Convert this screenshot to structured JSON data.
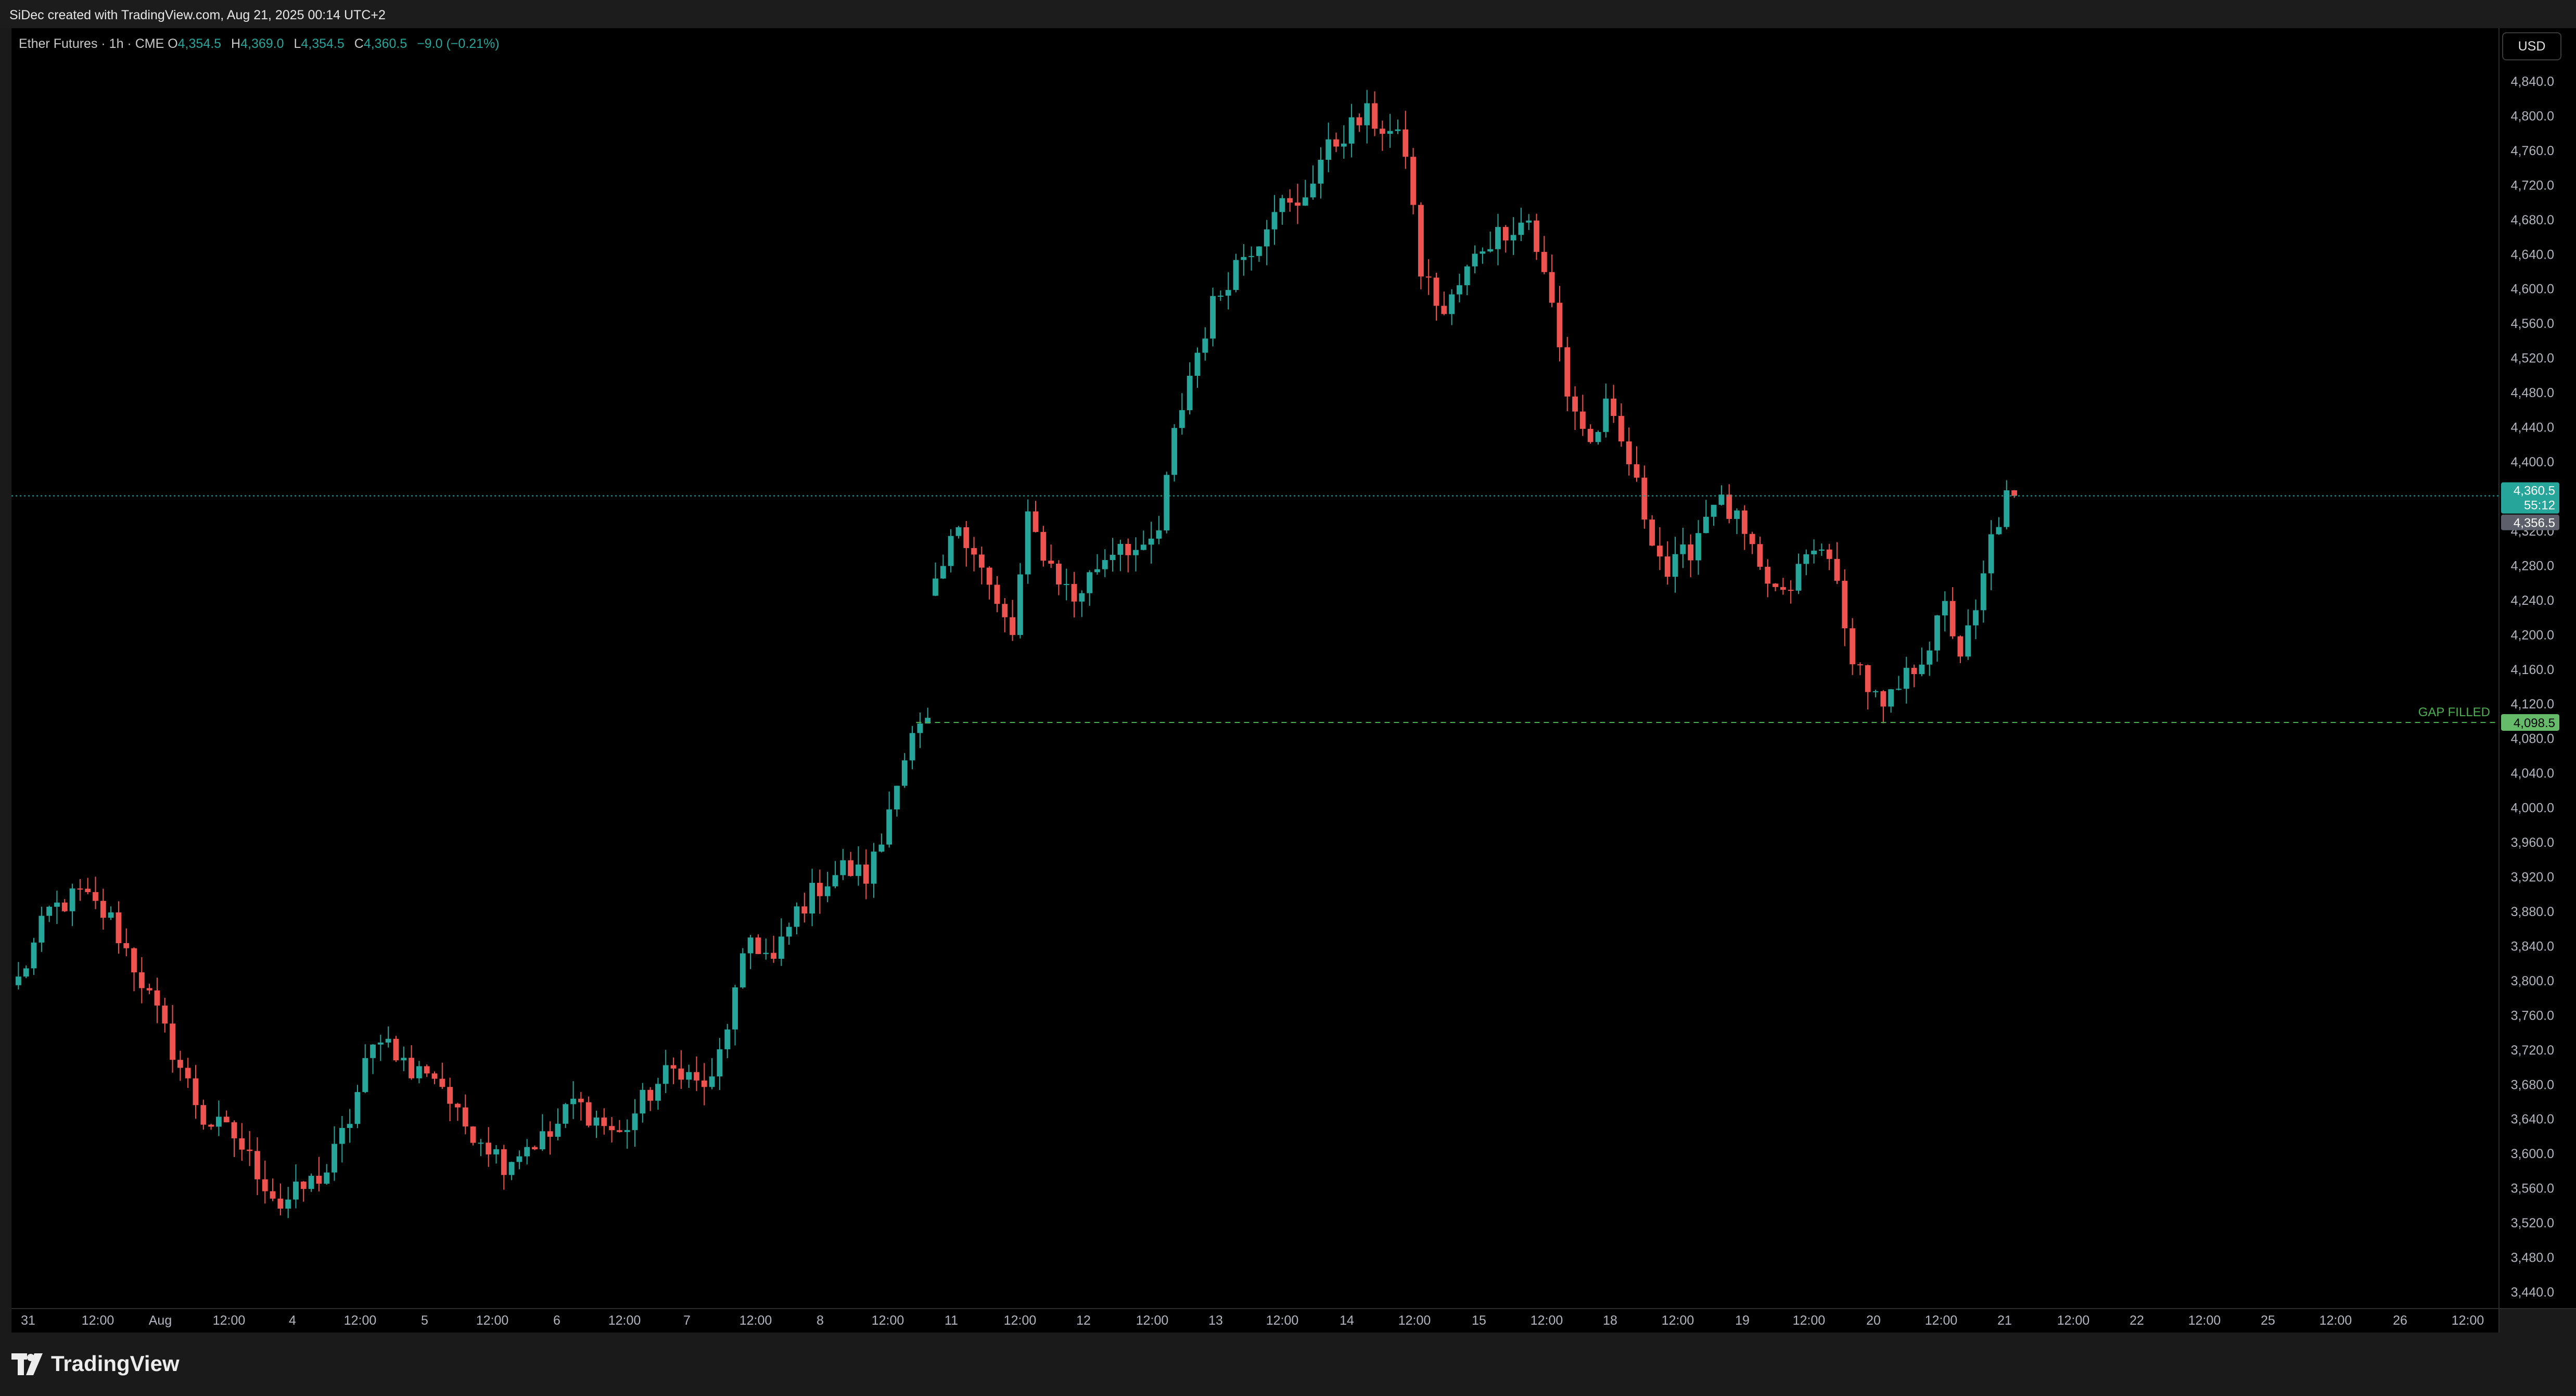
{
  "header": {
    "credit": "SiDec created with TradingView.com, Aug 21, 2025 00:14 UTC+2"
  },
  "legend": {
    "symbol": "Ether Futures · 1h · CME",
    "open_label": "O",
    "open": "4,354.5",
    "high_label": "H",
    "high": "4,369.0",
    "low_label": "L",
    "low": "4,354.5",
    "close_label": "C",
    "close": "4,360.5",
    "change": "−9.0 (−0.21%)"
  },
  "currency_button": "USD",
  "brand": {
    "name": "TradingView",
    "icon": "tradingview-logo-icon"
  },
  "colors": {
    "up": "#26a69a",
    "down": "#ef5350",
    "price_line": "#26a69a",
    "gap_line": "#4caf50",
    "background": "#000000"
  },
  "price_tags": {
    "last_price": "4,360.5",
    "countdown": "55:12",
    "prev_close": "4,356.5",
    "gap_price": "4,098.5"
  },
  "annotation": {
    "gap_label": "GAP FILLED"
  },
  "chart_data": {
    "type": "candlestick",
    "ylim": [
      3420,
      4860
    ],
    "y_ticks": [
      "4,840.0",
      "4,800.0",
      "4,760.0",
      "4,720.0",
      "4,680.0",
      "4,640.0",
      "4,600.0",
      "4,560.0",
      "4,520.0",
      "4,480.0",
      "4,440.0",
      "4,400.0",
      "4,360.0",
      "4,320.0",
      "4,280.0",
      "4,240.0",
      "4,200.0",
      "4,160.0",
      "4,120.0",
      "4,080.0",
      "4,040.0",
      "4,000.0",
      "3,960.0",
      "3,920.0",
      "3,880.0",
      "3,840.0",
      "3,800.0",
      "3,760.0",
      "3,720.0",
      "3,680.0",
      "3,640.0",
      "3,600.0",
      "3,560.0",
      "3,520.0",
      "3,480.0",
      "3,440.0"
    ],
    "x_ticks": [
      "31",
      "12:00",
      "Aug",
      "12:00",
      "4",
      "12:00",
      "5",
      "12:00",
      "6",
      "12:00",
      "7",
      "12:00",
      "8",
      "12:00",
      "11",
      "12:00",
      "12",
      "12:00",
      "13",
      "12:00",
      "14",
      "12:00",
      "15",
      "12:00",
      "18",
      "12:00",
      "19",
      "12:00",
      "20",
      "12:00",
      "21",
      "12:00",
      "22",
      "12:00",
      "25",
      "12:00",
      "26",
      "12:00"
    ],
    "last_price": 4360.5,
    "gap_level": 4098.5,
    "path_points": [
      [
        0,
        3800
      ],
      [
        4,
        3880
      ],
      [
        8,
        3900
      ],
      [
        12,
        3870
      ],
      [
        16,
        3800
      ],
      [
        18,
        3760
      ],
      [
        21,
        3700
      ],
      [
        24,
        3640
      ],
      [
        28,
        3620
      ],
      [
        31,
        3580
      ],
      [
        34,
        3540
      ],
      [
        37,
        3560
      ],
      [
        40,
        3580
      ],
      [
        43,
        3640
      ],
      [
        45,
        3700
      ],
      [
        47,
        3740
      ],
      [
        49,
        3720
      ],
      [
        51,
        3690
      ],
      [
        53,
        3700
      ],
      [
        55,
        3680
      ],
      [
        57,
        3640
      ],
      [
        60,
        3620
      ],
      [
        63,
        3590
      ],
      [
        66,
        3610
      ],
      [
        69,
        3620
      ],
      [
        72,
        3660
      ],
      [
        75,
        3640
      ],
      [
        78,
        3620
      ],
      [
        81,
        3660
      ],
      [
        84,
        3690
      ],
      [
        86,
        3700
      ],
      [
        88,
        3680
      ],
      [
        90,
        3680
      ],
      [
        92,
        3750
      ],
      [
        95,
        3850
      ],
      [
        98,
        3820
      ],
      [
        101,
        3880
      ],
      [
        104,
        3910
      ],
      [
        107,
        3930
      ],
      [
        110,
        3920
      ],
      [
        112,
        3960
      ],
      [
        114,
        4040
      ],
      [
        116,
        4080
      ],
      [
        118,
        4095
      ],
      [
        119,
        4250
      ],
      [
        122,
        4330
      ],
      [
        124,
        4300
      ],
      [
        127,
        4230
      ],
      [
        129,
        4200
      ],
      [
        131,
        4330
      ],
      [
        134,
        4280
      ],
      [
        137,
        4240
      ],
      [
        140,
        4280
      ],
      [
        143,
        4310
      ],
      [
        146,
        4290
      ],
      [
        148,
        4320
      ],
      [
        150,
        4430
      ],
      [
        152,
        4500
      ],
      [
        155,
        4580
      ],
      [
        158,
        4630
      ],
      [
        161,
        4660
      ],
      [
        163,
        4700
      ],
      [
        166,
        4690
      ],
      [
        169,
        4750
      ],
      [
        172,
        4780
      ],
      [
        175,
        4800
      ],
      [
        178,
        4780
      ],
      [
        180,
        4760
      ],
      [
        182,
        4620
      ],
      [
        185,
        4570
      ],
      [
        188,
        4620
      ],
      [
        190,
        4650
      ],
      [
        193,
        4670
      ],
      [
        196,
        4680
      ],
      [
        199,
        4580
      ],
      [
        201,
        4480
      ],
      [
        204,
        4420
      ],
      [
        206,
        4460
      ],
      [
        209,
        4400
      ],
      [
        211,
        4340
      ],
      [
        214,
        4270
      ],
      [
        217,
        4300
      ],
      [
        220,
        4360
      ],
      [
        223,
        4330
      ],
      [
        226,
        4270
      ],
      [
        229,
        4240
      ],
      [
        232,
        4290
      ],
      [
        235,
        4300
      ],
      [
        237,
        4200
      ],
      [
        240,
        4140
      ],
      [
        242,
        4110
      ],
      [
        245,
        4150
      ],
      [
        248,
        4190
      ],
      [
        250,
        4230
      ],
      [
        252,
        4180
      ],
      [
        254,
        4220
      ],
      [
        256,
        4310
      ],
      [
        258,
        4357
      ],
      [
        259,
        4360
      ]
    ]
  }
}
